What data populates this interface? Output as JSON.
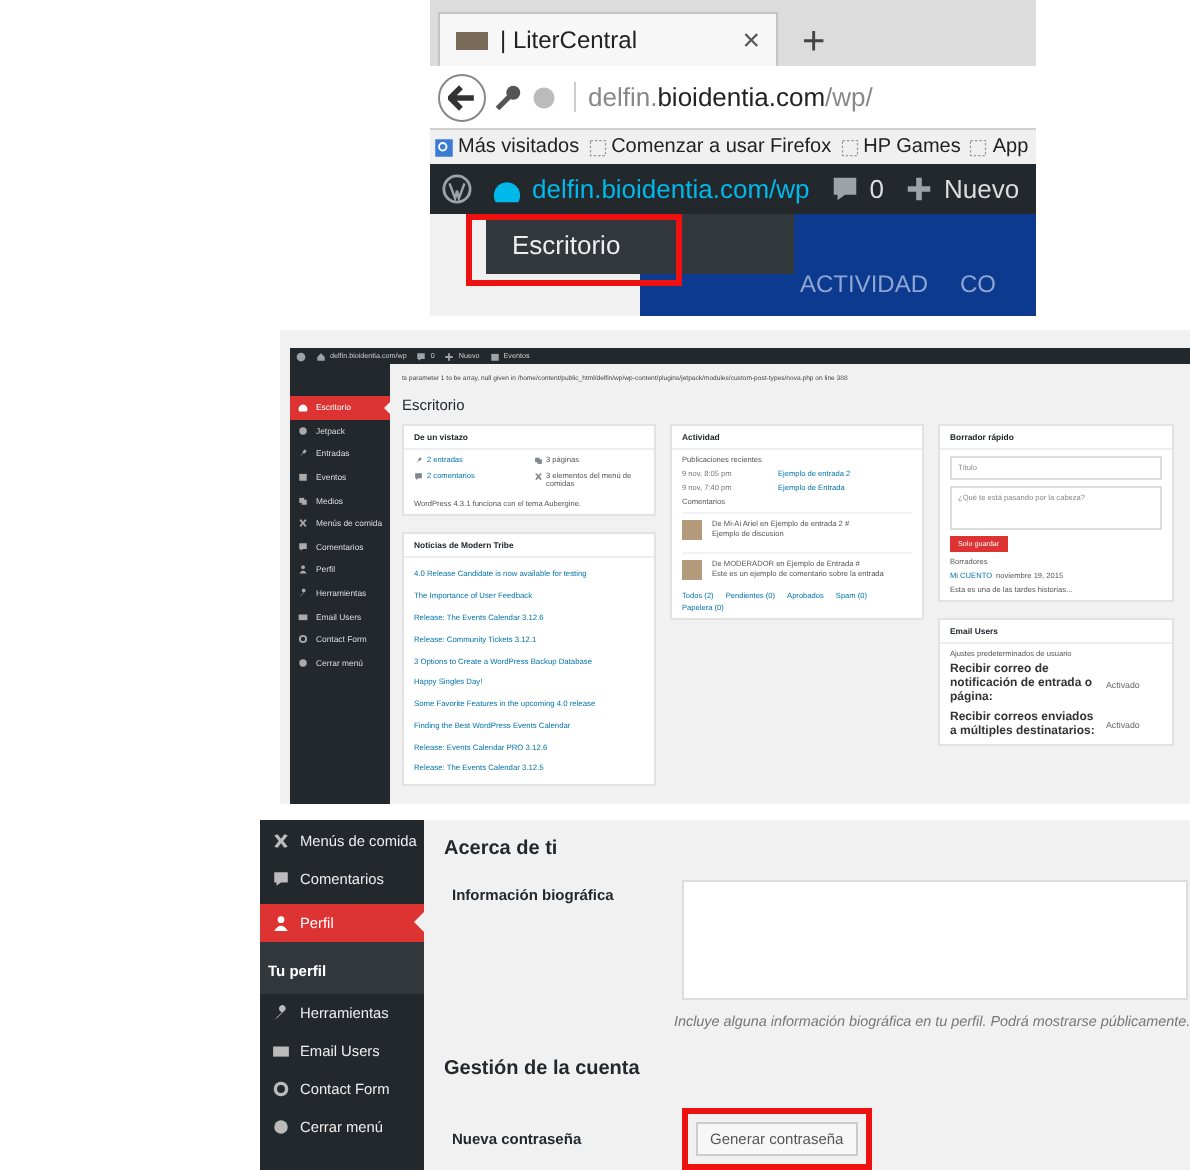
{
  "browser": {
    "tab": {
      "title": "| LiterCentral",
      "close": "×"
    },
    "new_tab": "+",
    "address": "delfin.**bioidentia.com**/wp/",
    "bookmarks": [
      {
        "label": "Más visitados",
        "kind": "folder"
      },
      {
        "label": "Comenzar a usar Firefox",
        "kind": "page"
      },
      {
        "label": "HP Games",
        "kind": "page"
      },
      {
        "label": "App",
        "kind": "page"
      }
    ],
    "admin_bar": {
      "site": "delfin.bioidentia.com/wp",
      "comments": "0",
      "new": "Nuevo"
    },
    "dropdown": [
      {
        "label": "Escritorio",
        "highlighted": true
      }
    ],
    "page_nav": [
      "ACTIVIDAD",
      "CO"
    ]
  },
  "dashboard": {
    "admin_bar": {
      "site": "delfin.bioidentia.com/wp",
      "comments": "0",
      "new": "Nuevo",
      "events": "Eventos"
    },
    "notice": "ts parameter 1 to be array, null given in /home/content/public_html/delfin/wp/wp-content/plugins/jetpack/modules/custom-post-types/nova.php on line 388",
    "title": "Escritorio",
    "menu": [
      {
        "label": "Escritorio",
        "selected": true
      },
      {
        "label": "Jetpack",
        "selected": false
      },
      {
        "label": "Entradas",
        "selected": false
      },
      {
        "label": "Eventos",
        "selected": false
      },
      {
        "label": "Medios",
        "selected": false
      },
      {
        "label": "Menús de comida",
        "selected": false
      },
      {
        "label": "Comentarios",
        "selected": false
      },
      {
        "label": "Perfil",
        "selected": false
      },
      {
        "label": "Herramientas",
        "selected": false
      },
      {
        "label": "Email Users",
        "selected": false
      },
      {
        "label": "Contact Form",
        "selected": false
      },
      {
        "label": "Cerrar menú",
        "selected": false
      }
    ],
    "at_a_glance": {
      "title": "De un vistazo",
      "stats": [
        {
          "text": "2 entradas",
          "kind": "link"
        },
        {
          "text": "3 páginas",
          "kind": "text"
        },
        {
          "text": "2 comentarios",
          "kind": "link"
        },
        {
          "text": "3 elementos del menú de comidas",
          "kind": "text"
        }
      ],
      "footer": "WordPress 4.3.1 funciona con el tema Aubergine."
    },
    "news": {
      "title": "Noticias de Modern Tribe",
      "items": [
        "4.0 Release Candidate is now available for testing",
        "The Importance of User Feedback",
        "Release: The Events Calendar 3.12.6",
        "Release: Community Tickets 3.12.1",
        "3 Options to Create a WordPress Backup Database",
        "Happy Singles Day!",
        "Some Favorite Features in the upcoming 4.0 release",
        "Finding the Best WordPress Events Calendar",
        "Release: Events Calendar PRO 3.12.6",
        "Release: The Events Calendar 3.12.5"
      ]
    },
    "activity": {
      "title": "Actividad",
      "recent_title": "Publicaciones recientes",
      "recent": [
        {
          "date": "9 nov, 8:05 pm",
          "title": "Ejemplo de entrada 2"
        },
        {
          "date": "9 nov, 7:40 pm",
          "title": "Ejemplo de Entrada"
        }
      ],
      "comments_title": "Comentarios",
      "comments": [
        {
          "meta": "De Mi-Ai Ariel en Ejemplo de entrada 2 #",
          "text": "Ejemplo de discusion"
        },
        {
          "meta": "De MODERADOR en Ejemplo de Entrada #",
          "text": "Este es un ejemplo de comentario sobre la entrada"
        }
      ],
      "filters": [
        "Todos (2)",
        "Pendientes (0)",
        "Aprobados",
        "Spam (0)",
        "Papelera (0)"
      ]
    },
    "quick_draft": {
      "title": "Borrador rápido",
      "title_placeholder": "Título",
      "content_placeholder": "¿Qué te está pasando por la cabeza?",
      "save": "Solo guardar",
      "drafts_title": "Borradores",
      "draft_title": "Mi CUENTO",
      "draft_date": "noviembre 19, 2015",
      "draft_excerpt": "Esta es una de las tardes historias..."
    },
    "email_users": {
      "title": "Email Users",
      "subtitle": "Ajustes predeterminados de usuario",
      "settings": [
        {
          "label": "Recibir correo de notificación de entrada o página:",
          "value": "Activado"
        },
        {
          "label": "Recibir correos enviados a múltiples destinatarios:",
          "value": "Activado"
        }
      ]
    }
  },
  "profile": {
    "menu": [
      {
        "label": "Menús de comida",
        "selected": false
      },
      {
        "label": "Comentarios",
        "selected": false
      },
      {
        "label": "Perfil",
        "selected": true,
        "children": [
          {
            "label": "Tu perfil",
            "selected": true
          }
        ]
      },
      {
        "label": "Herramientas",
        "selected": false
      },
      {
        "label": "Email Users",
        "selected": false
      },
      {
        "label": "Contact Form",
        "selected": false
      },
      {
        "label": "Cerrar menú",
        "selected": false
      }
    ],
    "about_title": "Acerca de ti",
    "bio_label": "Información biográfica",
    "bio_hint": "Incluye alguna información biográfica en tu perfil. Podrá mostrarse públicamente.",
    "account_title": "Gestión de la cuenta",
    "password_label": "Nueva contraseña",
    "generate_button": {
      "label": "Generar contraseña",
      "highlighted": true
    }
  }
}
